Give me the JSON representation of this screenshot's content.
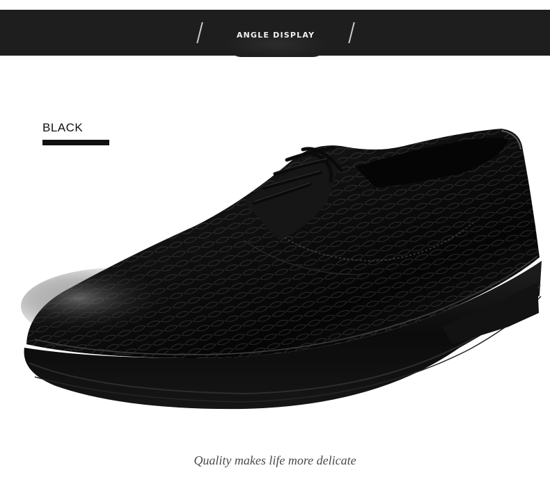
{
  "banner": {
    "title": "ANGLE DISPLAY"
  },
  "color_option": {
    "label": "BLACK"
  },
  "photo": {
    "subject": "black crocodile-embossed leather lace-up derby shoe"
  },
  "tagline": "Quality makes life more delicate",
  "colors": {
    "banner_bg": "#1e1e1e",
    "banner_text": "#f2f2f2",
    "label_text": "#111111",
    "tagline_text": "#4a4a4a"
  }
}
